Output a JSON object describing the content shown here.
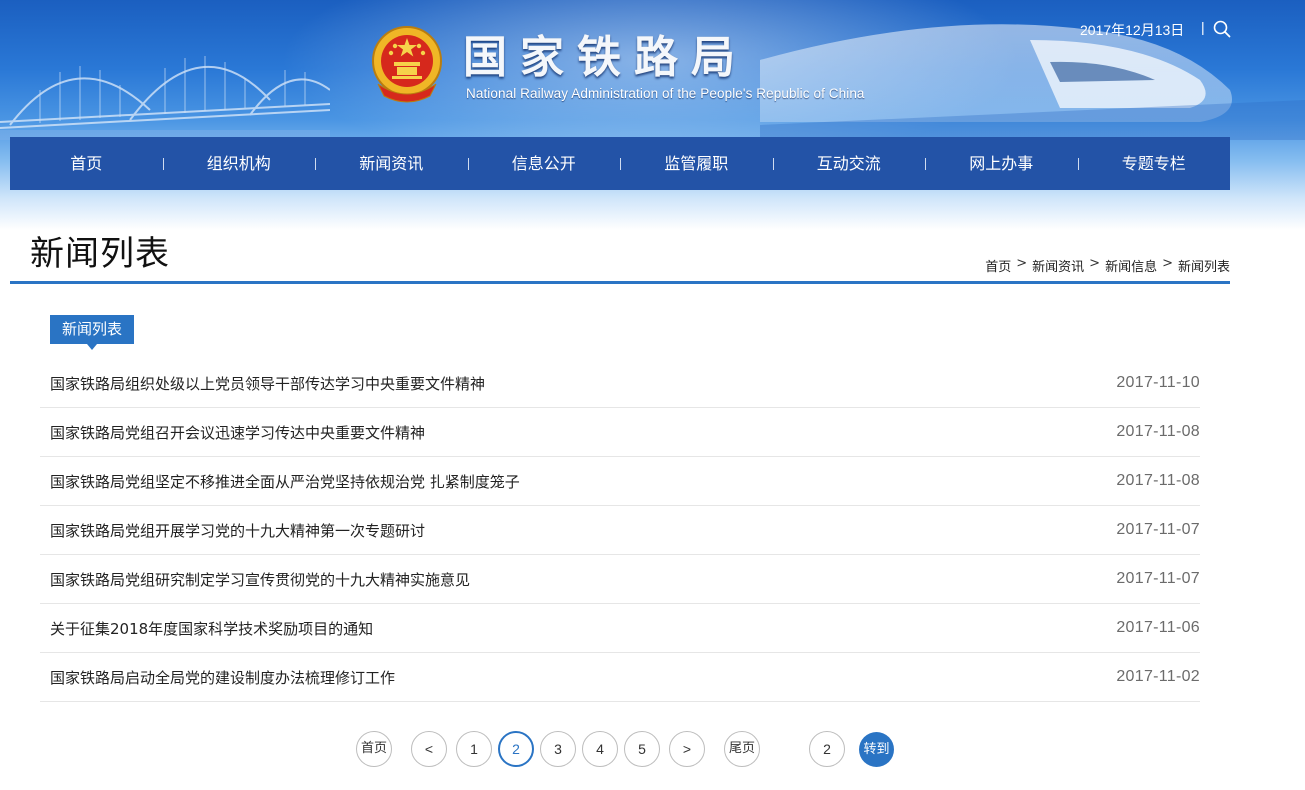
{
  "header": {
    "title": "国家铁路局",
    "subtitle": "National Railway Administration of the People's Republic of China",
    "date": "2017年12月13日",
    "separator": "|",
    "search_icon": "search-icon",
    "emblem_icon": "national-emblem-icon"
  },
  "nav": {
    "items": [
      {
        "label": "首页"
      },
      {
        "label": "组织机构"
      },
      {
        "label": "新闻资讯"
      },
      {
        "label": "信息公开"
      },
      {
        "label": "监管履职"
      },
      {
        "label": "互动交流"
      },
      {
        "label": "网上办事"
      },
      {
        "label": "专题专栏"
      }
    ]
  },
  "page": {
    "heading": "新闻列表",
    "breadcrumb": [
      {
        "label": "首页"
      },
      {
        "label": "新闻资讯"
      },
      {
        "label": "新闻信息"
      },
      {
        "label": "新闻列表"
      }
    ],
    "breadcrumb_separator": ">",
    "section_tag": "新闻列表"
  },
  "news": [
    {
      "title": "国家铁路局组织处级以上党员领导干部传达学习中央重要文件精神",
      "date": "2017-11-10"
    },
    {
      "title": "国家铁路局党组召开会议迅速学习传达中央重要文件精神",
      "date": "2017-11-08"
    },
    {
      "title": "国家铁路局党组坚定不移推进全面从严治党坚持依规治党 扎紧制度笼子",
      "date": "2017-11-08"
    },
    {
      "title": "国家铁路局党组开展学习党的十九大精神第一次专题研讨",
      "date": "2017-11-07"
    },
    {
      "title": "国家铁路局党组研究制定学习宣传贯彻党的十九大精神实施意见",
      "date": "2017-11-07"
    },
    {
      "title": "关于征集2018年度国家科学技术奖励项目的通知",
      "date": "2017-11-06"
    },
    {
      "title": "国家铁路局启动全局党的建设制度办法梳理修订工作",
      "date": "2017-11-02"
    }
  ],
  "pagination": {
    "first": "首页",
    "prev": "<",
    "pages": [
      "1",
      "2",
      "3",
      "4",
      "5"
    ],
    "current": "2",
    "next": ">",
    "last": "尾页",
    "jump_value": "2",
    "go": "转到"
  },
  "colors": {
    "nav_bg": "#2353a7",
    "accent": "#2a74c4"
  }
}
